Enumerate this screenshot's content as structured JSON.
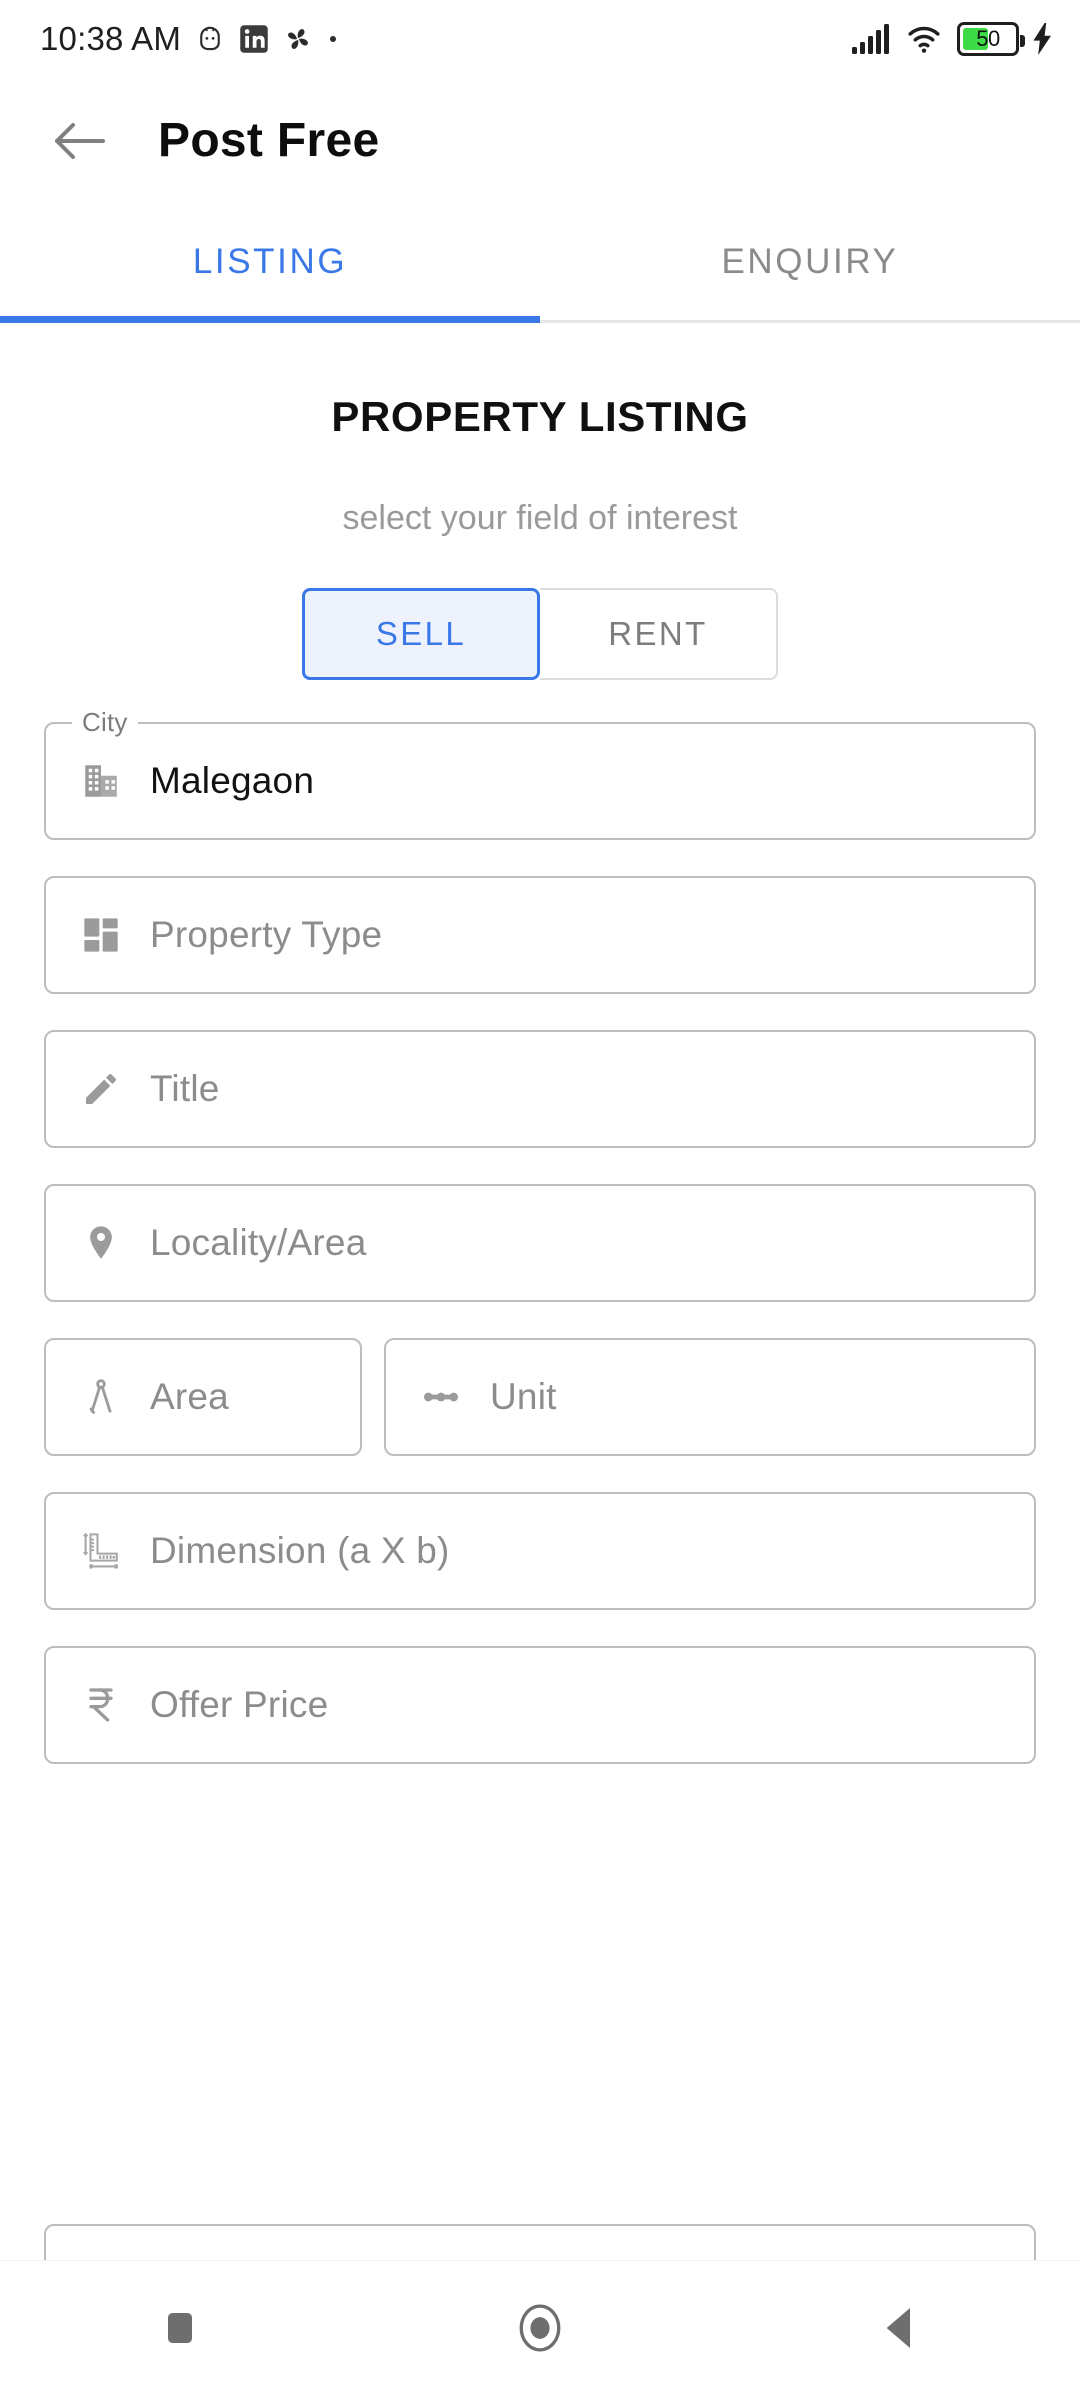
{
  "status_bar": {
    "time": "10:38 AM",
    "notif_icons": [
      "android-face-icon",
      "linkedin-icon",
      "pinwheel-icon",
      "dot-icon"
    ],
    "signal_icon": "signal-bars-icon",
    "wifi_icon": "wifi-icon",
    "battery": {
      "level": "50",
      "charging": true,
      "fill_color": "#3ddc47"
    }
  },
  "app_bar": {
    "back_icon": "back-arrow-icon",
    "title": "Post Free"
  },
  "tabs": {
    "active_color": "#3b78e7",
    "inactive_color": "#8a8a8a",
    "items": [
      {
        "label": "LISTING",
        "active": true
      },
      {
        "label": "ENQUIRY",
        "active": false
      }
    ]
  },
  "form": {
    "heading": "PROPERTY LISTING",
    "subheading": "select your field of interest",
    "segment": {
      "selected": "SELL",
      "options": [
        {
          "label": "SELL",
          "selected": true
        },
        {
          "label": "RENT",
          "selected": false
        }
      ],
      "selected_bg": "#eef2fc",
      "selected_border": "#3b78e7"
    },
    "fields": [
      {
        "label": "City",
        "value": "Malegaon",
        "placeholder": "City",
        "icon": "building-icon",
        "filled": true
      },
      {
        "label": "",
        "value": "",
        "placeholder": "Property Type",
        "icon": "dashboard-grid-icon",
        "filled": false
      },
      {
        "label": "",
        "value": "",
        "placeholder": "Title",
        "icon": "pencil-edit-icon",
        "filled": false
      },
      {
        "label": "",
        "value": "",
        "placeholder": "Locality/Area",
        "icon": "location-pin-icon",
        "filled": false
      },
      {
        "label": "",
        "value": "",
        "placeholder": "Area",
        "icon": "compass-divider-icon",
        "filled": false
      },
      {
        "label": "",
        "value": "",
        "placeholder": "Unit",
        "icon": "linear-scale-icon",
        "filled": false
      },
      {
        "label": "",
        "value": "",
        "placeholder": "Dimension (a X b)",
        "icon": "ruler-square-icon",
        "filled": false
      },
      {
        "label": "",
        "value": "",
        "placeholder": "Offer Price",
        "icon": "rupee-icon",
        "filled": false
      }
    ]
  },
  "nav_bar": {
    "buttons": [
      {
        "name": "recents",
        "icon": "square-icon"
      },
      {
        "name": "home",
        "icon": "circle-icon"
      },
      {
        "name": "back",
        "icon": "triangle-left-icon"
      }
    ]
  }
}
